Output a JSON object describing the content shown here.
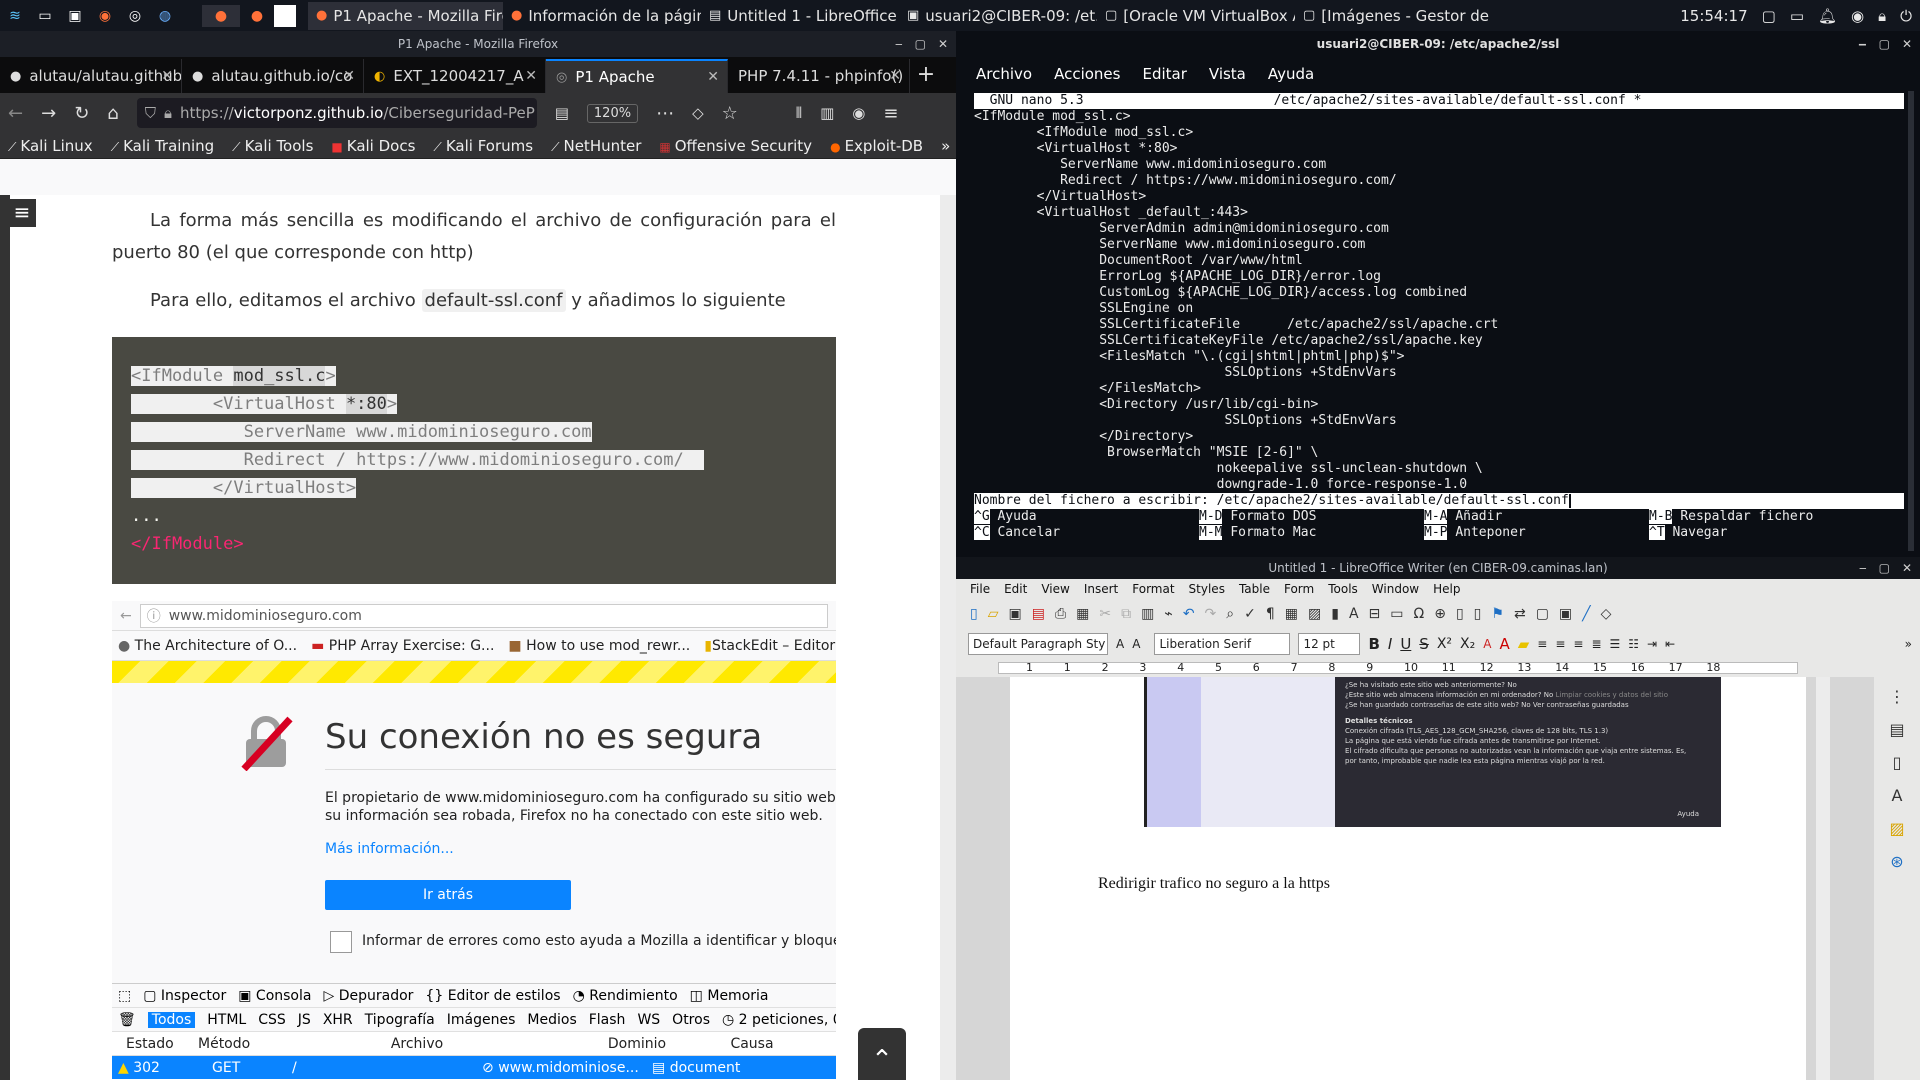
{
  "taskbar": {
    "tasks": [
      {
        "label": "P1 Apache - Mozilla Fire..."
      },
      {
        "label": "Información de la página..."
      },
      {
        "label": "Untitled 1 - LibreOffice ..."
      },
      {
        "label": "usuari2@CIBER-09: /et..."
      },
      {
        "label": "[Oracle VM VirtualBox A..."
      },
      {
        "label": "[Imágenes - Gestor de a..."
      }
    ],
    "clock": "15:54:17"
  },
  "firefox": {
    "window_title": "P1 Apache - Mozilla Firefox",
    "tabs": [
      {
        "label": "alutau/alutau.github"
      },
      {
        "label": "alutau.github.io/co"
      },
      {
        "label": "EXT_12004217_A"
      },
      {
        "label": "P1 Apache"
      },
      {
        "label": "PHP 7.4.11 - phpinfo()"
      }
    ],
    "url_prefix": "https://",
    "url_host": "victorponz.github.io",
    "url_path": "/Ciberseguridad-PeP",
    "zoom": "120%",
    "bookmarks": [
      {
        "label": "Kali Linux"
      },
      {
        "label": "Kali Training"
      },
      {
        "label": "Kali Tools"
      },
      {
        "label": "Kali Docs"
      },
      {
        "label": "Kali Forums"
      },
      {
        "label": "NetHunter"
      },
      {
        "label": "Offensive Security"
      },
      {
        "label": "Exploit-DB"
      }
    ],
    "page": {
      "para1": "La forma más sencilla es modificando el archivo de configuración para el puerto 80 (el que corresponde con http)",
      "para2_before": "Para ello, editamos el archivo ",
      "para2_code": "default-ssl.conf",
      "para2_after": " y añadimos lo siguiente",
      "code_lines": [
        {
          "pre": "",
          "sel1": "<IfModule ",
          "sel2": "mod_ssl.c",
          "sel3": ">"
        },
        {
          "pre": "",
          "sel1": "        <VirtualHost ",
          "sel2": "*:80",
          "sel3": ">"
        },
        {
          "pre": "",
          "sel1": "           ServerName www.midominioseguro.com",
          "sel2": "",
          "sel3": ""
        },
        {
          "pre": "",
          "sel1": "           Redirect / https://www.midominioseguro.com/  ",
          "sel2": "",
          "sel3": ""
        },
        {
          "pre": "",
          "sel1": "        </VirtualHost>",
          "sel2": "",
          "sel3": ""
        }
      ],
      "code_ellipsis": "...",
      "code_end": "</IfModule>",
      "shot": {
        "url": "www.midominioseguro.com",
        "bookmarks": [
          {
            "label": "The Architecture of O..."
          },
          {
            "label": "PHP Array Exercise: G..."
          },
          {
            "label": "How to use mod_rewr..."
          },
          {
            "label": "StackEdit – Editor"
          }
        ],
        "error_title": "Su conexión no es segura",
        "error_desc1": "El propietario de www.midominioseguro.com ha configurado su sitio web de",
        "error_desc2": "su información sea robada, Firefox no ha conectado con este sitio web.",
        "more_info": "Más información...",
        "back_button": "Ir atrás",
        "report_label": "Informar de errores como esto ayuda a Mozilla a identificar y bloquear s",
        "devtools_tabs": [
          "Inspector",
          "Consola",
          "Depurador",
          "Editor de estilos",
          "Rendimiento",
          "Memoria"
        ],
        "filters": [
          "Todos",
          "HTML",
          "CSS",
          "JS",
          "XHR",
          "Tipografía",
          "Imágenes",
          "Medios",
          "Flash",
          "WS",
          "Otros"
        ],
        "requests_count": "2 peticiones, 0",
        "columns": [
          "Estado",
          "Método",
          "Archivo",
          "Dominio",
          "Causa"
        ],
        "row": {
          "status": "302",
          "method": "GET",
          "file": "/",
          "domain": "www.midominiose...",
          "cause": "document"
        }
      }
    }
  },
  "terminal": {
    "title": "usuari2@CIBER-09: /etc/apache2/ssl",
    "menu": [
      "Archivo",
      "Acciones",
      "Editar",
      "Vista",
      "Ayuda"
    ],
    "nano_header_left": "  GNU nano 5.3",
    "nano_header_file": "/etc/apache2/sites-available/default-ssl.conf *",
    "lines": [
      "<IfModule mod_ssl.c>",
      "        <IfModule mod_ssl.c>",
      "        <VirtualHost *:80>",
      "           ServerName www.midominioseguro.com",
      "           Redirect / https://www.midominioseguro.com/",
      "        </VirtualHost>",
      "        <VirtualHost _default_:443>",
      "                ServerAdmin admin@midominioseguro.com",
      "                ServerName www.midominioseguro.com",
      "                DocumentRoot /var/www/html",
      "                ErrorLog ${APACHE_LOG_DIR}/error.log",
      "                CustomLog ${APACHE_LOG_DIR}/access.log combined",
      "                SSLEngine on",
      "                SSLCertificateFile      /etc/apache2/ssl/apache.crt",
      "                SSLCertificateKeyFile /etc/apache2/ssl/apache.key",
      "                <FilesMatch \"\\.(cgi|shtml|phtml|php)$\">",
      "                                SSLOptions +StdEnvVars",
      "                </FilesMatch>",
      "                <Directory /usr/lib/cgi-bin>",
      "                                SSLOptions +StdEnvVars",
      "                </Directory>",
      "                 BrowserMatch \"MSIE [2-6]\" \\",
      "                               nokeepalive ssl-unclean-shutdown \\",
      "                               downgrade-1.0 force-response-1.0"
    ],
    "prompt": "Nombre del fichero a escribir: /etc/apache2/sites-available/default-ssl.conf",
    "shortcuts_row1": [
      {
        "key": "^G",
        "label": "Ayuda"
      },
      {
        "key": "M-D",
        "label": "Formato DOS"
      },
      {
        "key": "M-A",
        "label": "Añadir"
      },
      {
        "key": "M-B",
        "label": "Respaldar fichero"
      }
    ],
    "shortcuts_row2": [
      {
        "key": "^C",
        "label": "Cancelar"
      },
      {
        "key": "M-M",
        "label": "Formato Mac"
      },
      {
        "key": "M-P",
        "label": "Anteponer"
      },
      {
        "key": "^T",
        "label": "Navegar"
      }
    ]
  },
  "writer": {
    "title": "Untitled 1 - LibreOffice Writer (en CIBER-09.caminas.lan)",
    "menu": [
      "File",
      "Edit",
      "View",
      "Insert",
      "Format",
      "Styles",
      "Table",
      "Form",
      "Tools",
      "Window",
      "Help"
    ],
    "para_style": "Default Paragraph Sty",
    "font_name": "Liberation Serif",
    "font_size": "12 pt",
    "ruler_marks": [
      "1",
      "1",
      "2",
      "3",
      "4",
      "5",
      "6",
      "7",
      "8",
      "9",
      "10",
      "11",
      "12",
      "13",
      "14",
      "15",
      "16",
      "17",
      "18"
    ],
    "dialog_lines": [
      "¿Se ha visitado este sitio web anteriormente?   No",
      "¿Este sitio web almacena información en mi ordenador?   No",
      "¿Se han guardado contraseñas de este sitio web?   No",
      "Detalles técnicos",
      "Conexión cifrada (TLS_AES_128_GCM_SHA256, claves de 128 bits, TLS 1.3)",
      "La página que está viendo fue cifrada antes de transmitirse por Internet.",
      "El cifrado dificulta que personas no autorizadas vean la información que viaja entre sistemas. Es,",
      "por tanto, improbable que nadie lea esta página mientras viajó por la red."
    ],
    "dialog_btn1": "Limpiar cookies y datos del sitio",
    "dialog_btn2": "Ver contraseñas guardadas",
    "dialog_help": "Ayuda",
    "doc_text": "Redirigir trafico no seguro a la https"
  }
}
